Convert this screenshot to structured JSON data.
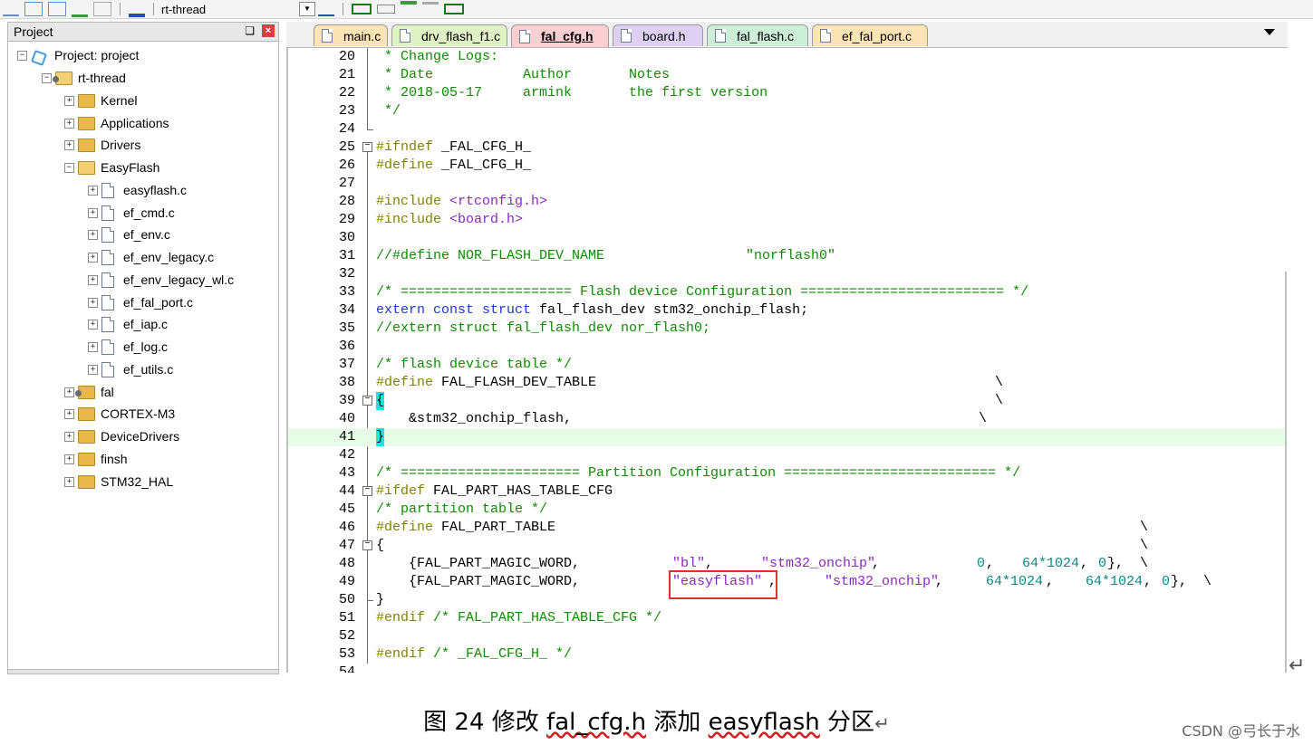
{
  "toolbar": {
    "target": "rt-thread"
  },
  "project_panel": {
    "title": "Project",
    "pin": "❑",
    "close": "×",
    "items": [
      {
        "label": "Project: project",
        "kind": "project",
        "expand": "−"
      },
      {
        "label": "rt-thread",
        "kind": "folder-special",
        "expand": "−"
      },
      {
        "label": "Kernel",
        "kind": "folder",
        "expand": "+"
      },
      {
        "label": "Applications",
        "kind": "folder",
        "expand": "+"
      },
      {
        "label": "Drivers",
        "kind": "folder",
        "expand": "+"
      },
      {
        "label": "EasyFlash",
        "kind": "folder-open",
        "expand": "−"
      },
      {
        "label": "easyflash.c",
        "kind": "file",
        "expand": "+"
      },
      {
        "label": "ef_cmd.c",
        "kind": "file",
        "expand": "+"
      },
      {
        "label": "ef_env.c",
        "kind": "file",
        "expand": "+"
      },
      {
        "label": "ef_env_legacy.c",
        "kind": "file",
        "expand": "+"
      },
      {
        "label": "ef_env_legacy_wl.c",
        "kind": "file",
        "expand": "+"
      },
      {
        "label": "ef_fal_port.c",
        "kind": "file",
        "expand": "+"
      },
      {
        "label": "ef_iap.c",
        "kind": "file",
        "expand": "+"
      },
      {
        "label": "ef_log.c",
        "kind": "file",
        "expand": "+"
      },
      {
        "label": "ef_utils.c",
        "kind": "file",
        "expand": "+"
      },
      {
        "label": "fal",
        "kind": "folder-special",
        "expand": "+"
      },
      {
        "label": "CORTEX-M3",
        "kind": "folder",
        "expand": "+"
      },
      {
        "label": "DeviceDrivers",
        "kind": "folder",
        "expand": "+"
      },
      {
        "label": "finsh",
        "kind": "folder",
        "expand": "+"
      },
      {
        "label": "STM32_HAL",
        "kind": "folder",
        "expand": "+"
      }
    ]
  },
  "tabs": [
    {
      "label": "main.c",
      "color": "#fde4b4"
    },
    {
      "label": "drv_flash_f1.c",
      "color": "#dff2c6"
    },
    {
      "label": "fal_cfg.h",
      "color": "#fbcfd2",
      "active": true
    },
    {
      "label": "board.h",
      "color": "#ddd0f2"
    },
    {
      "label": "fal_flash.c",
      "color": "#cdeed7"
    },
    {
      "label": "ef_fal_port.c",
      "color": "#fde4b4"
    }
  ],
  "code": {
    "l20": "* Change Logs:",
    "l21": "* Date           Author       Notes",
    "l22": "* 2018-05-17     armink       the first version",
    "l23": "*/",
    "l25a": "#ifndef",
    "l25b": " _FAL_CFG_H_",
    "l26a": "#define",
    "l26b": " _FAL_CFG_H_",
    "l28a": "#include ",
    "l28b": "<rtconfig.h>",
    "l29a": "#include ",
    "l29b": "<board.h>",
    "l31a": "//#define NOR_FLASH_DEV_NAME",
    "l31b": "\"norflash0\"",
    "l33": "/* ===================== Flash device Configuration ========================= */",
    "l34a": "extern const struct",
    "l34b": " fal_flash_dev stm32_onchip_flash;",
    "l35": "//extern struct fal_flash_dev nor_flash0;",
    "l37": "/* flash device table */",
    "l38a": "#define",
    "l38b": " FAL_FLASH_DEV_TABLE",
    "bs": "\\",
    "l39": "{",
    "l40": "    &stm32_onchip_flash,",
    "l41": "}",
    "l43": "/* ====================== Partition Configuration ========================== */",
    "l44a": "#ifdef",
    "l44b": " FAL_PART_HAS_TABLE_CFG",
    "l45": "/* partition table */",
    "l46a": "#define",
    "l46b": " FAL_PART_TABLE",
    "l47": "{",
    "l48a": "    {FAL_PART_MAGIC_WORD,",
    "l48b": "\"bl\"",
    "l48c": ",",
    "l48d": "\"stm32_onchip\"",
    "l48e": ",",
    "l48f": "0",
    "l48g": ",",
    "l48h": "64*1024",
    "l48i": ",",
    "l48j": "0",
    "l48k": "},",
    "l49a": "    {FAL_PART_MAGIC_WORD,",
    "l49b": "\"easyflash\"",
    "l49c": ",",
    "l49d": "\"stm32_onchip\"",
    "l49e": ",",
    "l49f": "64*1024",
    "l49g": ",",
    "l49h": "64*1024",
    "l49i": ",",
    "l49j": "0",
    "l49k": "},",
    "l50": "}",
    "l51a": "#endif",
    "l51b": " /* FAL_PART_HAS_TABLE_CFG */",
    "l53a": "#endif",
    "l53b": " /* _FAL_CFG_H_ */"
  },
  "line_numbers": [
    "20",
    "21",
    "22",
    "23",
    "24",
    "25",
    "26",
    "27",
    "28",
    "29",
    "30",
    "31",
    "32",
    "33",
    "34",
    "35",
    "36",
    "37",
    "38",
    "39",
    "40",
    "41",
    "42",
    "43",
    "44",
    "45",
    "46",
    "47",
    "48",
    "49",
    "50",
    "51",
    "52",
    "53",
    "54"
  ],
  "caption": {
    "prefix": "图  24 修改 ",
    "file": "fal_cfg.h",
    "middle": " 添加 ",
    "name": "easyflash",
    "suffix": " 分区",
    "mark": "↵"
  },
  "watermark": "CSDN @弓长于水",
  "return_mark": "↵"
}
